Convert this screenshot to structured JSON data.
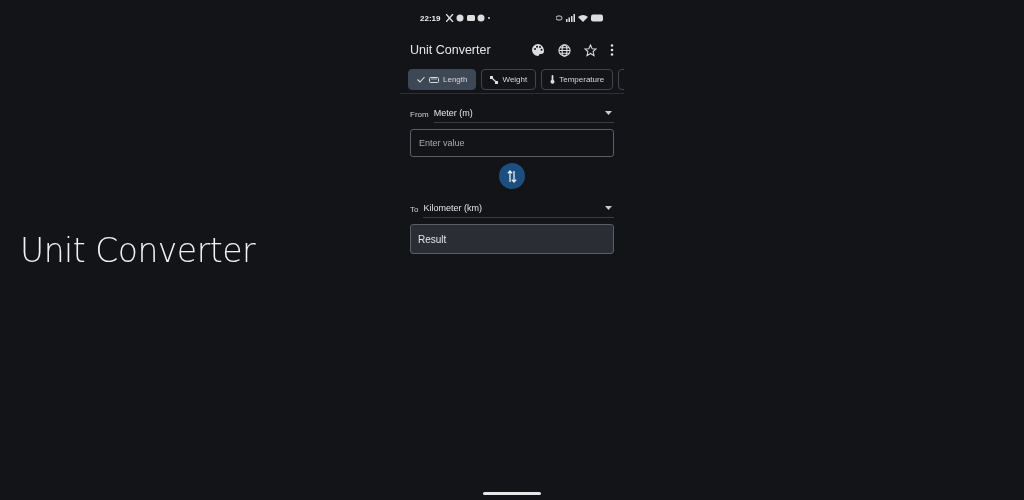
{
  "promo_title": "Unit Converter",
  "status_bar": {
    "time": "22:19"
  },
  "app_bar": {
    "title": "Unit Converter"
  },
  "tabs": [
    {
      "label": "Length",
      "kind": "length",
      "selected": true
    },
    {
      "label": "Weight",
      "kind": "weight",
      "selected": false
    },
    {
      "label": "Temperature",
      "kind": "temperature",
      "selected": false
    }
  ],
  "from": {
    "label": "From",
    "unit": "Meter (m)",
    "placeholder": "Enter value"
  },
  "to": {
    "label": "To",
    "unit": "Kilometer (km)",
    "result": "Result"
  }
}
